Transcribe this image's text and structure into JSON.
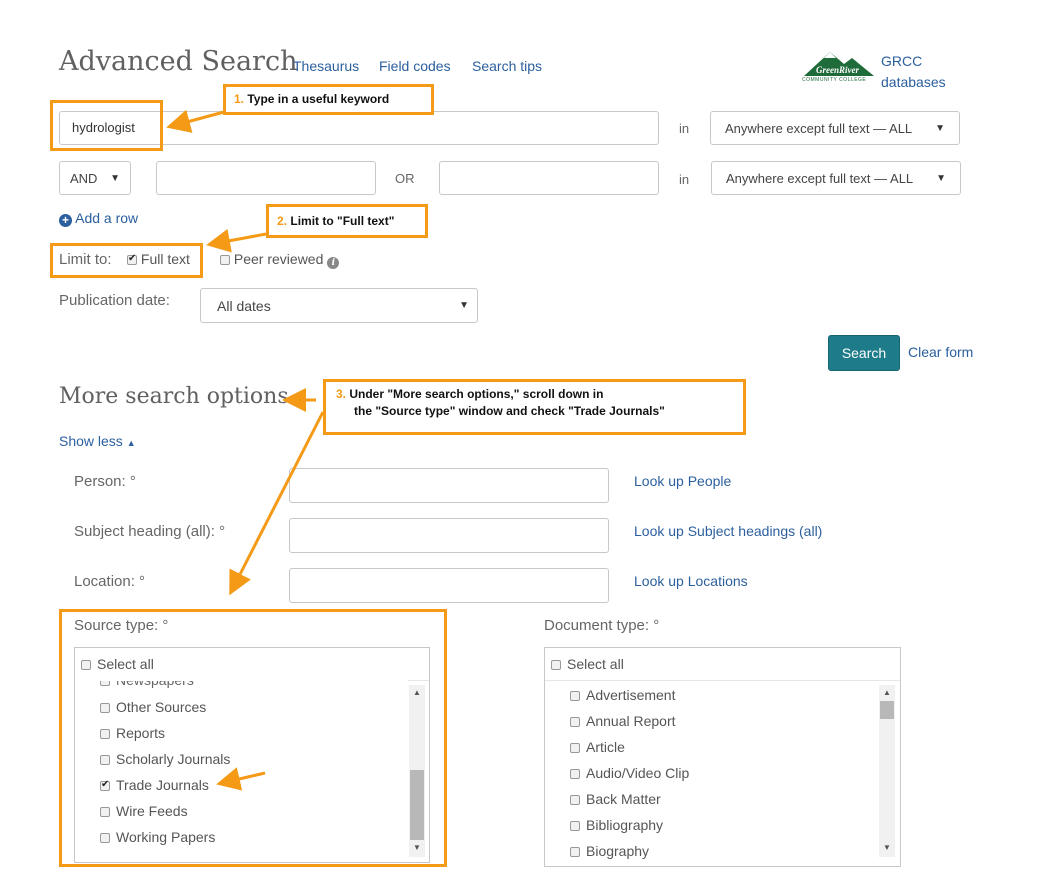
{
  "header": {
    "title": "Advanced Search",
    "links": [
      "Thesaurus",
      "Field codes",
      "Search tips"
    ],
    "logo_text": "GreenRiver",
    "logo_sub": "COMMUNITY COLLEGE",
    "db_link_line1": "GRCC",
    "db_link_line2": "databases"
  },
  "row1": {
    "keyword": "hydrologist",
    "in_label": "in",
    "field": "Anywhere except full text — ALL"
  },
  "row2": {
    "operator": "AND",
    "or_label": "OR",
    "in_label": "in",
    "field": "Anywhere except full text — ALL"
  },
  "add_row": "Add a row",
  "limit": {
    "label": "Limit to:",
    "full_text": "Full text",
    "full_text_checked": true,
    "peer_reviewed": "Peer reviewed",
    "peer_reviewed_checked": false
  },
  "pubdate": {
    "label": "Publication date:",
    "value": "All dates"
  },
  "buttons": {
    "search": "Search",
    "clear": "Clear form"
  },
  "more_options": {
    "title": "More search options",
    "show_less": "Show less"
  },
  "fields": [
    {
      "label": "Person: °",
      "lookup": "Look up People"
    },
    {
      "label": "Subject heading (all): °",
      "lookup": "Look up Subject headings (all)"
    },
    {
      "label": "Location: °",
      "lookup": "Look up Locations"
    }
  ],
  "source_type": {
    "label": "Source type: °",
    "select_all": "Select all",
    "partial_item": "Newspapers",
    "items": [
      {
        "label": "Other Sources",
        "checked": false
      },
      {
        "label": "Reports",
        "checked": false
      },
      {
        "label": "Scholarly Journals",
        "checked": false
      },
      {
        "label": "Trade Journals",
        "checked": true
      },
      {
        "label": "Wire Feeds",
        "checked": false
      },
      {
        "label": "Working Papers",
        "checked": false
      }
    ]
  },
  "document_type": {
    "label": "Document type: °",
    "select_all": "Select all",
    "items": [
      "Advertisement",
      "Annual Report",
      "Article",
      "Audio/Video Clip",
      "Back Matter",
      "Bibliography",
      "Biography"
    ]
  },
  "callouts": {
    "c1_num": "1.",
    "c1_text": "Type in a useful keyword",
    "c2_num": "2.",
    "c2_text": "Limit to \"Full text\"",
    "c3_num": "3.",
    "c3_line1": "Under \"More search options,\" scroll down in",
    "c3_line2": "the \"Source type\" window and check \"Trade Journals\""
  },
  "colors": {
    "accent_orange": "#f49a16",
    "link_blue": "#2b5f9e",
    "search_teal": "#1e7b8a",
    "logo_green": "#1f6b3a"
  }
}
